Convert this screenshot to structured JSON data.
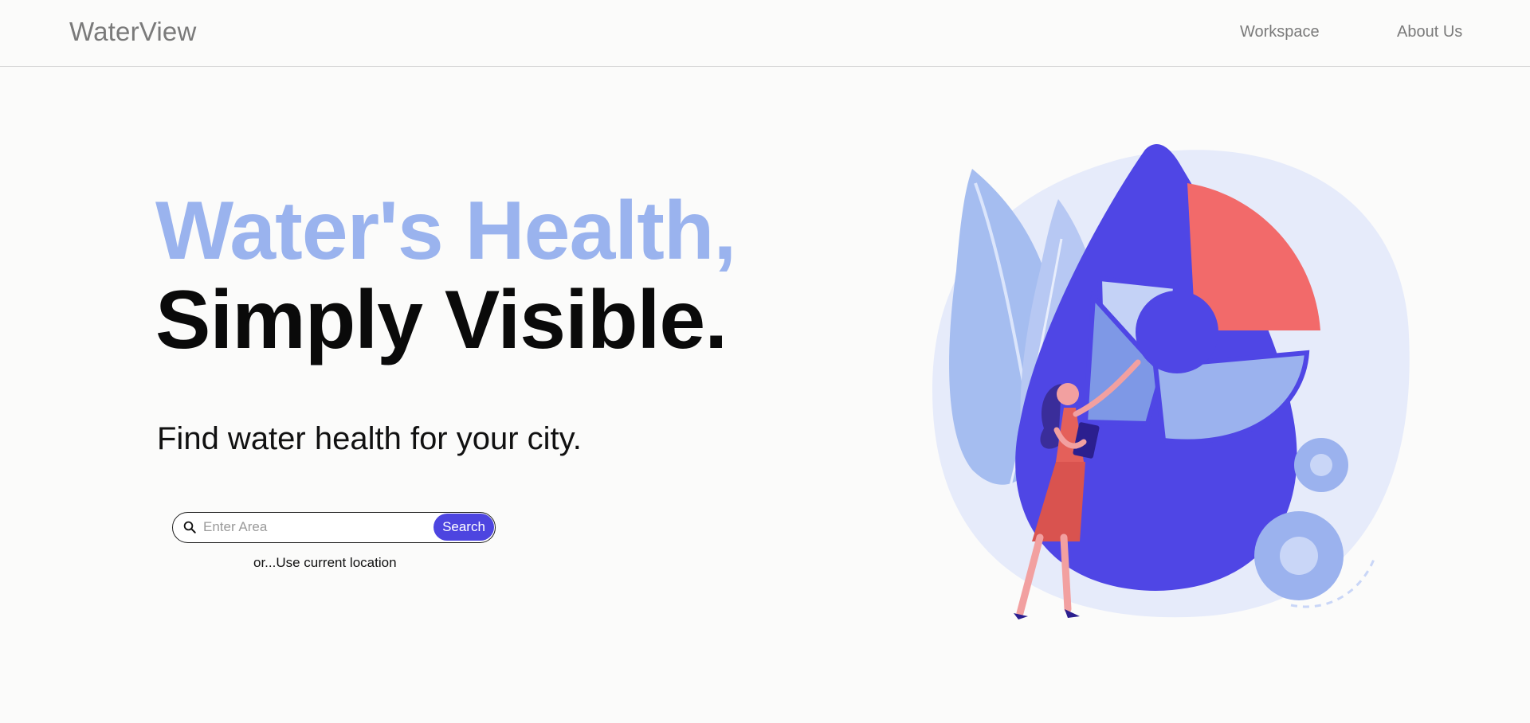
{
  "header": {
    "brand": "WaterView",
    "nav": {
      "workspace": "Workspace",
      "about": "About Us"
    }
  },
  "hero": {
    "line1": "Water's Health,",
    "line2": "Simply Visible.",
    "subtitle": "Find water health for your city."
  },
  "search": {
    "placeholder": "Enter Area",
    "value": "",
    "button_label": "Search",
    "location_link": "or...Use current location"
  },
  "colors": {
    "accent": "#4d45e0",
    "headline_light": "#9ab3ee",
    "drop": "#4f46e5",
    "highlight": "#f26a6a"
  },
  "icons": [
    "search-icon"
  ]
}
